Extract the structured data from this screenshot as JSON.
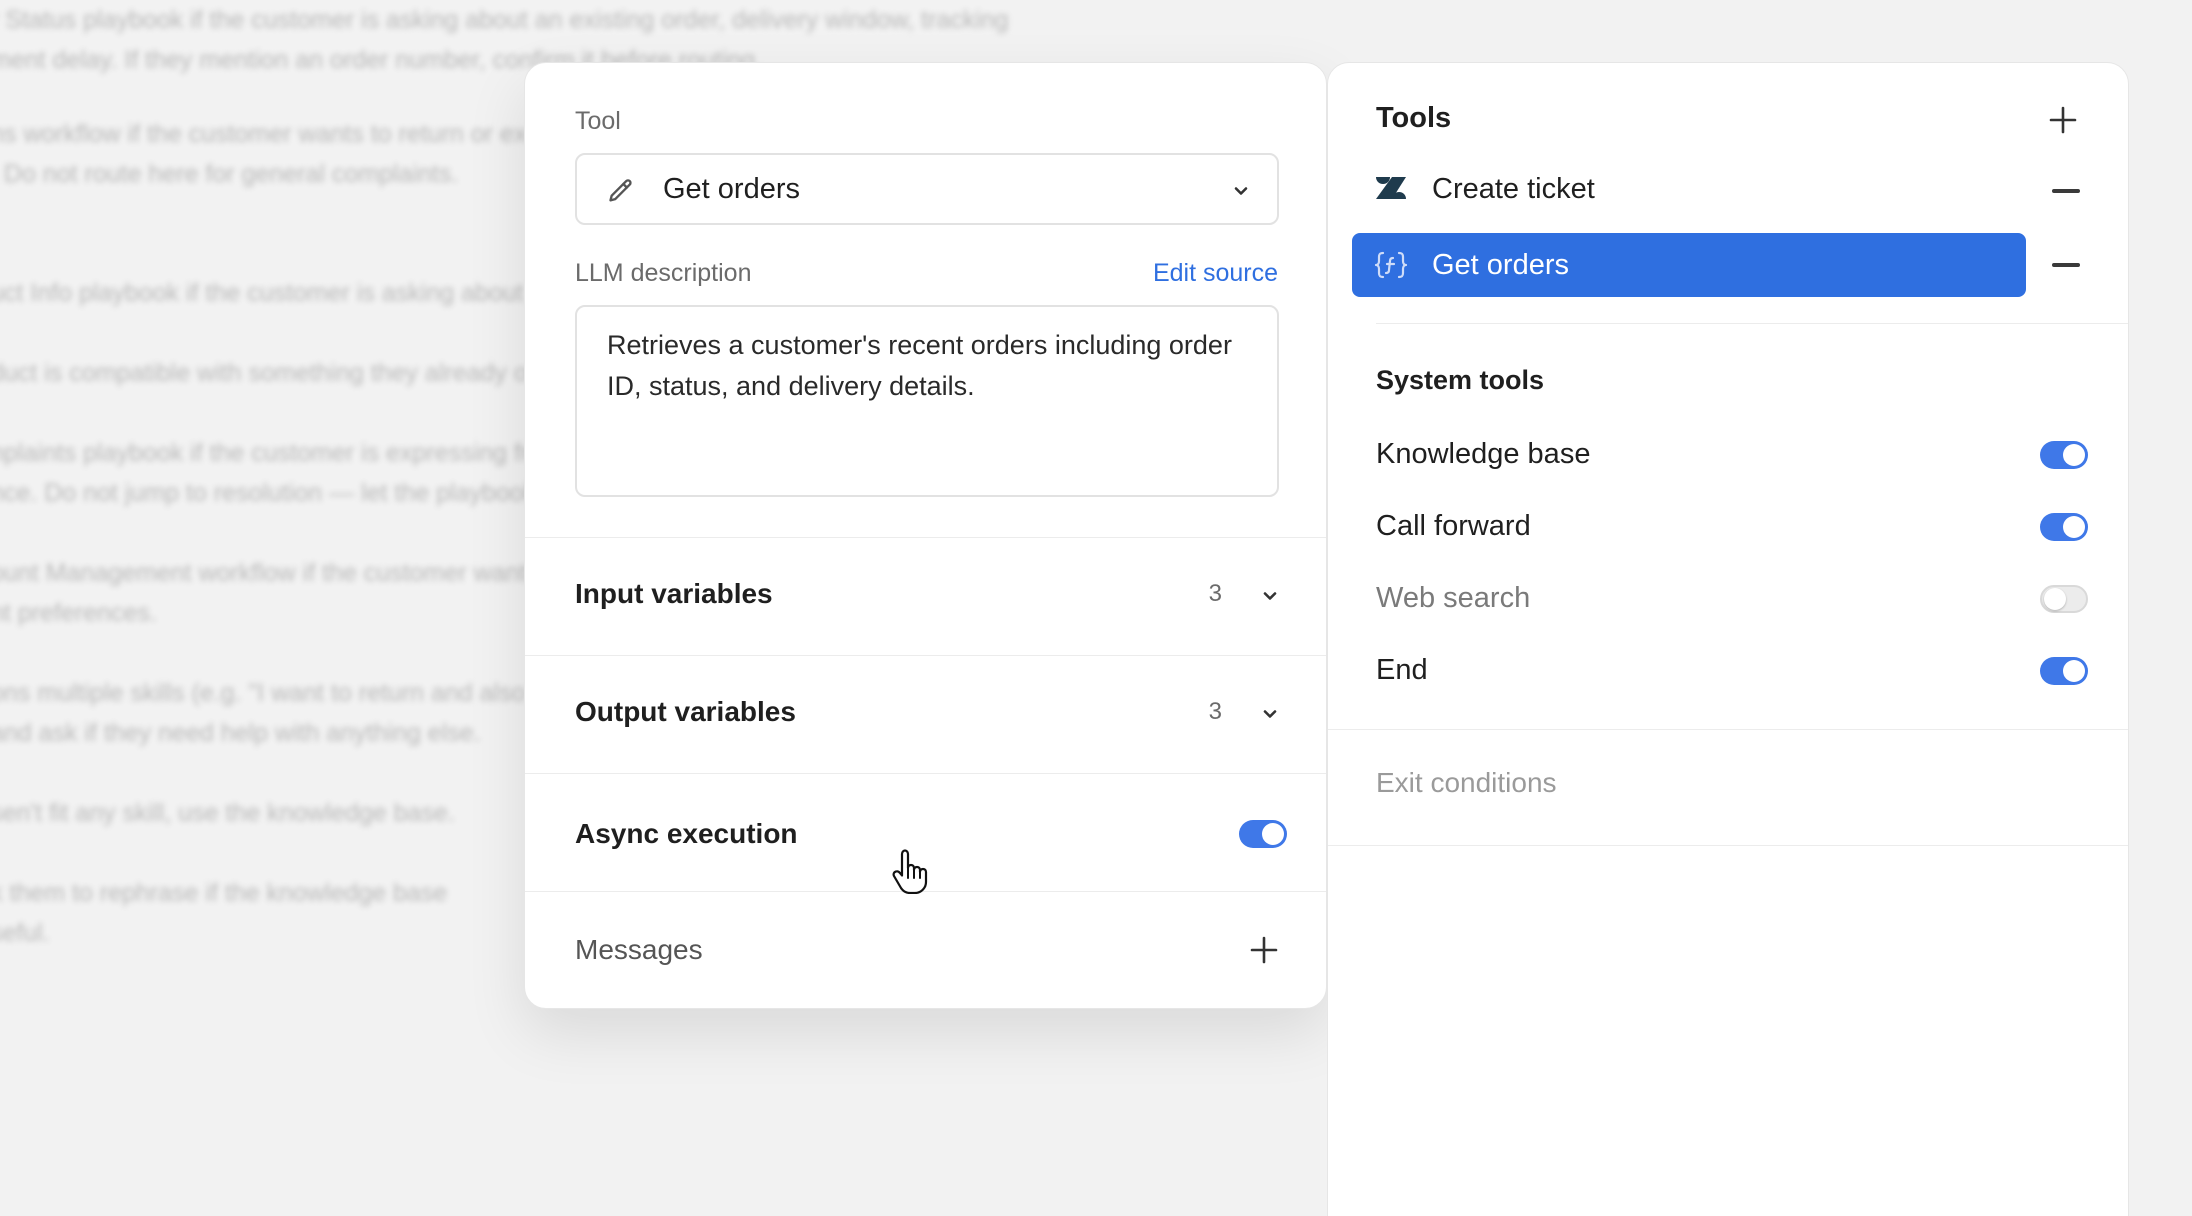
{
  "background_doc": {
    "paragraphs": [
      [
        "r Status playbook if the customer is asking about an existing order, delivery window, tracking",
        "ment delay. If they mention an order number, confirm it before routing."
      ],
      [
        "ns workflow if the customer wants to return or exchange an item.",
        ". Do not route here for general complaints."
      ],
      [
        "uct Info playbook if the customer is asking about a product."
      ],
      [
        "duct is compatible with something they already own."
      ],
      [
        "nplaints playbook if the customer is expressing frustration.",
        "nce. Do not jump to resolution — let the playbook handle it."
      ],
      [
        "ount Management workflow if the customer wants to update account",
        "nt preferences."
      ],
      [
        "ons multiple skills (e.g. \"I want to return and also",
        "and ask if they need help with anything else."
      ],
      [
        "sen't fit any skill, use the knowledge base."
      ],
      [
        "k them to rephrase if the knowledge base",
        "seful."
      ]
    ]
  },
  "tool_editor": {
    "tool_label": "Tool",
    "selected_tool": "Get orders",
    "llm_description_label": "LLM description",
    "edit_source_label": "Edit source",
    "llm_description": "Retrieves a customer's recent orders including order ID, status, and delivery details.",
    "input_variables": {
      "label": "Input variables",
      "count": "3"
    },
    "output_variables": {
      "label": "Output variables",
      "count": "3"
    },
    "async_execution": {
      "label": "Async execution",
      "enabled": true
    },
    "messages_label": "Messages"
  },
  "tools_panel": {
    "title": "Tools",
    "tools": [
      {
        "label": "Create ticket",
        "icon": "zendesk-logo-icon",
        "selected": false
      },
      {
        "label": "Get orders",
        "icon": "function-braces-icon",
        "selected": true
      }
    ],
    "system_tools_title": "System tools",
    "system_tools": [
      {
        "label": "Knowledge base",
        "enabled": true
      },
      {
        "label": "Call forward",
        "enabled": true
      },
      {
        "label": "Web search",
        "enabled": false
      },
      {
        "label": "End",
        "enabled": true
      }
    ],
    "exit_conditions_label": "Exit conditions"
  },
  "colors": {
    "accent": "#2f6fe0",
    "toggle_on": "#3f78e8",
    "background": "#f2f2f2"
  }
}
